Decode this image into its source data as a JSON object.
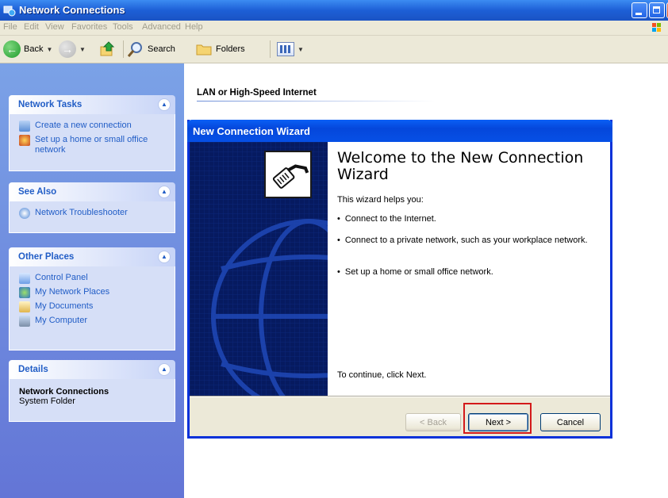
{
  "window": {
    "title": "Network Connections",
    "accent": "#2364e6"
  },
  "menubar": {
    "items": [
      "File",
      "Edit",
      "View",
      "Favorites",
      "Tools",
      "Advanced",
      "Help"
    ]
  },
  "toolbar": {
    "back_label": "Back",
    "search_label": "Search",
    "folders_label": "Folders"
  },
  "leftpane": {
    "network_tasks": {
      "title": "Network Tasks",
      "items": [
        "Create a new connection",
        "Set up a home or small office network"
      ]
    },
    "see_also": {
      "title": "See Also",
      "items": [
        "Network Troubleshooter"
      ]
    },
    "other_places": {
      "title": "Other Places",
      "items": [
        "Control Panel",
        "My Network Places",
        "My Documents",
        "My Computer"
      ]
    },
    "details": {
      "title": "Details",
      "name": "Network Connections",
      "type": "System Folder"
    }
  },
  "main": {
    "group_header": "LAN or High-Speed Internet"
  },
  "wizard": {
    "title": "New Connection Wizard",
    "heading": "Welcome to the New Connection Wizard",
    "intro": "This wizard helps you:",
    "bullets": [
      "Connect to the Internet.",
      "Connect to a private network, such as your workplace network.",
      "Set up a home or small office network."
    ],
    "continue_text": "To continue, click Next.",
    "back_button": "< Back",
    "next_button": "Next >",
    "cancel_button": "Cancel"
  },
  "highlight_color": "#d31a1a"
}
